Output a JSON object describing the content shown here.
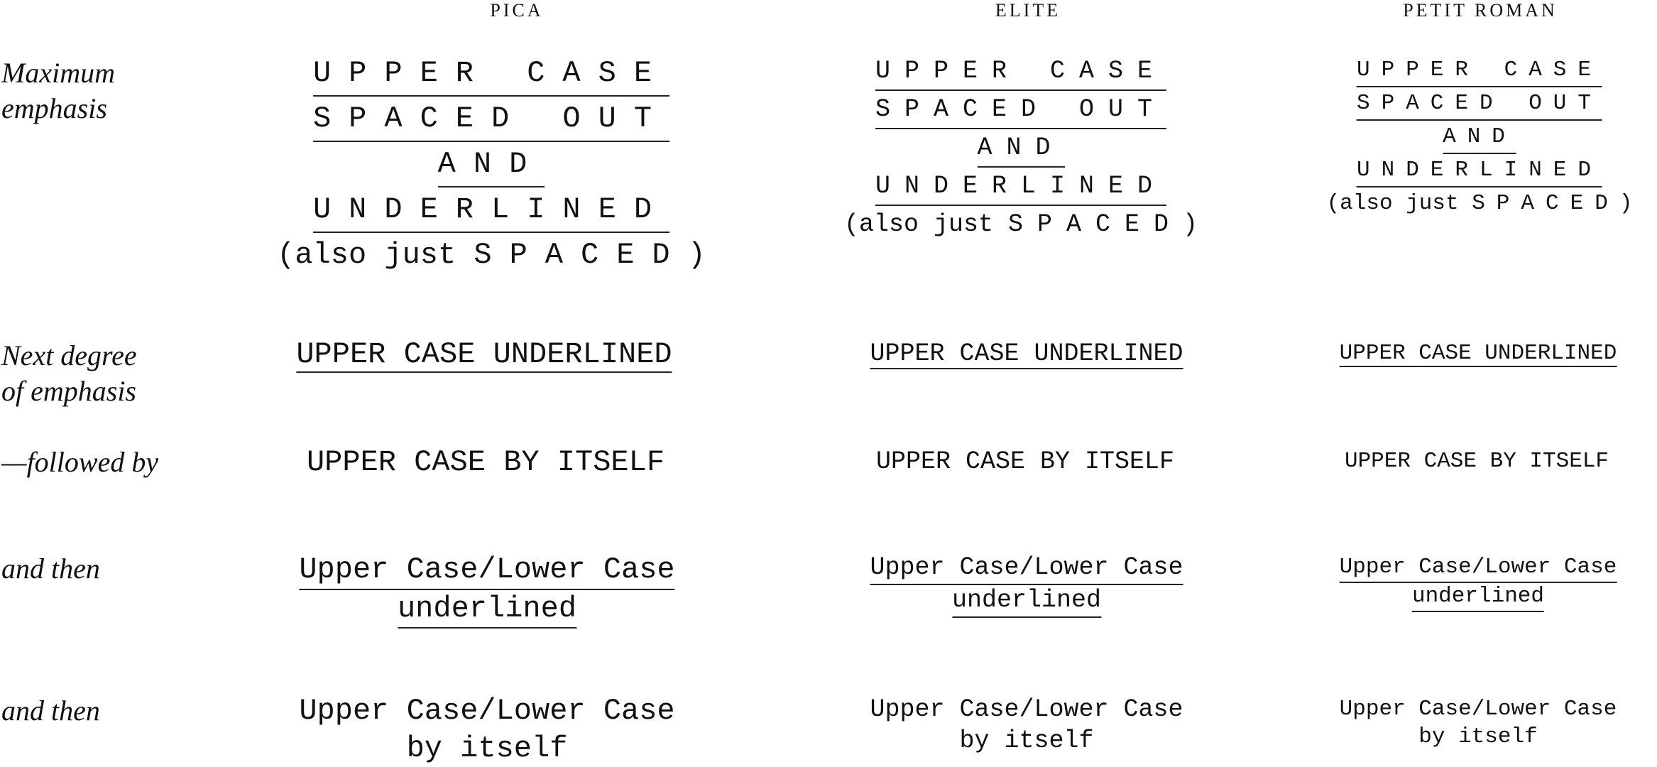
{
  "columns": [
    "PICA",
    "ELITE",
    "PETIT ROMAN"
  ],
  "row_labels": {
    "maximum": [
      "Maximum",
      "emphasis"
    ],
    "next": [
      "Next degree",
      "of emphasis"
    ],
    "followed": "—followed by",
    "then1": "and then",
    "then2": "and then"
  },
  "samples": {
    "max": [
      "UPPER CASE",
      "SPACED OUT",
      "AND",
      "UNDERLINED"
    ],
    "spaced_prefix": "(also just ",
    "spaced_word": "SPACED",
    "spaced_suffix": ")",
    "uc_underlined": "UPPER CASE UNDERLINED",
    "uc_itself": "UPPER CASE BY ITSELF",
    "ulc": "Upper Case/Lower Case",
    "underlined": "underlined",
    "by_itself": "by itself"
  }
}
